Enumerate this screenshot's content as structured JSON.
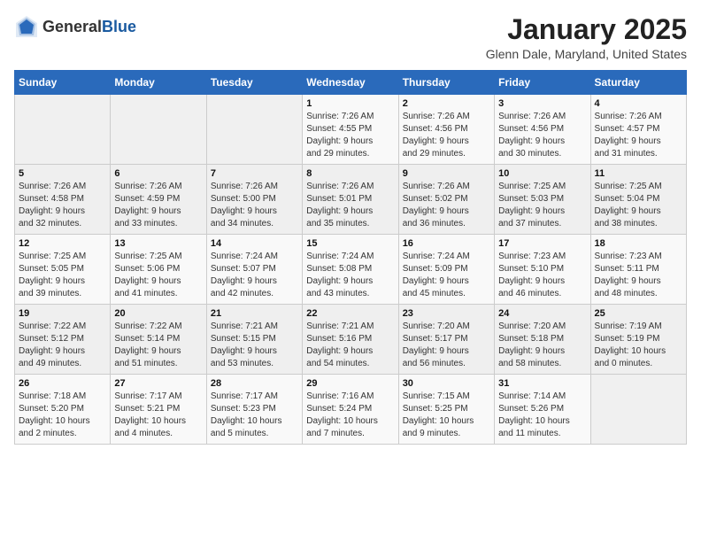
{
  "header": {
    "logo_general": "General",
    "logo_blue": "Blue",
    "title": "January 2025",
    "subtitle": "Glenn Dale, Maryland, United States"
  },
  "weekdays": [
    "Sunday",
    "Monday",
    "Tuesday",
    "Wednesday",
    "Thursday",
    "Friday",
    "Saturday"
  ],
  "weeks": [
    [
      {
        "day": "",
        "detail": ""
      },
      {
        "day": "",
        "detail": ""
      },
      {
        "day": "",
        "detail": ""
      },
      {
        "day": "1",
        "detail": "Sunrise: 7:26 AM\nSunset: 4:55 PM\nDaylight: 9 hours\nand 29 minutes."
      },
      {
        "day": "2",
        "detail": "Sunrise: 7:26 AM\nSunset: 4:56 PM\nDaylight: 9 hours\nand 29 minutes."
      },
      {
        "day": "3",
        "detail": "Sunrise: 7:26 AM\nSunset: 4:56 PM\nDaylight: 9 hours\nand 30 minutes."
      },
      {
        "day": "4",
        "detail": "Sunrise: 7:26 AM\nSunset: 4:57 PM\nDaylight: 9 hours\nand 31 minutes."
      }
    ],
    [
      {
        "day": "5",
        "detail": "Sunrise: 7:26 AM\nSunset: 4:58 PM\nDaylight: 9 hours\nand 32 minutes."
      },
      {
        "day": "6",
        "detail": "Sunrise: 7:26 AM\nSunset: 4:59 PM\nDaylight: 9 hours\nand 33 minutes."
      },
      {
        "day": "7",
        "detail": "Sunrise: 7:26 AM\nSunset: 5:00 PM\nDaylight: 9 hours\nand 34 minutes."
      },
      {
        "day": "8",
        "detail": "Sunrise: 7:26 AM\nSunset: 5:01 PM\nDaylight: 9 hours\nand 35 minutes."
      },
      {
        "day": "9",
        "detail": "Sunrise: 7:26 AM\nSunset: 5:02 PM\nDaylight: 9 hours\nand 36 minutes."
      },
      {
        "day": "10",
        "detail": "Sunrise: 7:25 AM\nSunset: 5:03 PM\nDaylight: 9 hours\nand 37 minutes."
      },
      {
        "day": "11",
        "detail": "Sunrise: 7:25 AM\nSunset: 5:04 PM\nDaylight: 9 hours\nand 38 minutes."
      }
    ],
    [
      {
        "day": "12",
        "detail": "Sunrise: 7:25 AM\nSunset: 5:05 PM\nDaylight: 9 hours\nand 39 minutes."
      },
      {
        "day": "13",
        "detail": "Sunrise: 7:25 AM\nSunset: 5:06 PM\nDaylight: 9 hours\nand 41 minutes."
      },
      {
        "day": "14",
        "detail": "Sunrise: 7:24 AM\nSunset: 5:07 PM\nDaylight: 9 hours\nand 42 minutes."
      },
      {
        "day": "15",
        "detail": "Sunrise: 7:24 AM\nSunset: 5:08 PM\nDaylight: 9 hours\nand 43 minutes."
      },
      {
        "day": "16",
        "detail": "Sunrise: 7:24 AM\nSunset: 5:09 PM\nDaylight: 9 hours\nand 45 minutes."
      },
      {
        "day": "17",
        "detail": "Sunrise: 7:23 AM\nSunset: 5:10 PM\nDaylight: 9 hours\nand 46 minutes."
      },
      {
        "day": "18",
        "detail": "Sunrise: 7:23 AM\nSunset: 5:11 PM\nDaylight: 9 hours\nand 48 minutes."
      }
    ],
    [
      {
        "day": "19",
        "detail": "Sunrise: 7:22 AM\nSunset: 5:12 PM\nDaylight: 9 hours\nand 49 minutes."
      },
      {
        "day": "20",
        "detail": "Sunrise: 7:22 AM\nSunset: 5:14 PM\nDaylight: 9 hours\nand 51 minutes."
      },
      {
        "day": "21",
        "detail": "Sunrise: 7:21 AM\nSunset: 5:15 PM\nDaylight: 9 hours\nand 53 minutes."
      },
      {
        "day": "22",
        "detail": "Sunrise: 7:21 AM\nSunset: 5:16 PM\nDaylight: 9 hours\nand 54 minutes."
      },
      {
        "day": "23",
        "detail": "Sunrise: 7:20 AM\nSunset: 5:17 PM\nDaylight: 9 hours\nand 56 minutes."
      },
      {
        "day": "24",
        "detail": "Sunrise: 7:20 AM\nSunset: 5:18 PM\nDaylight: 9 hours\nand 58 minutes."
      },
      {
        "day": "25",
        "detail": "Sunrise: 7:19 AM\nSunset: 5:19 PM\nDaylight: 10 hours\nand 0 minutes."
      }
    ],
    [
      {
        "day": "26",
        "detail": "Sunrise: 7:18 AM\nSunset: 5:20 PM\nDaylight: 10 hours\nand 2 minutes."
      },
      {
        "day": "27",
        "detail": "Sunrise: 7:17 AM\nSunset: 5:21 PM\nDaylight: 10 hours\nand 4 minutes."
      },
      {
        "day": "28",
        "detail": "Sunrise: 7:17 AM\nSunset: 5:23 PM\nDaylight: 10 hours\nand 5 minutes."
      },
      {
        "day": "29",
        "detail": "Sunrise: 7:16 AM\nSunset: 5:24 PM\nDaylight: 10 hours\nand 7 minutes."
      },
      {
        "day": "30",
        "detail": "Sunrise: 7:15 AM\nSunset: 5:25 PM\nDaylight: 10 hours\nand 9 minutes."
      },
      {
        "day": "31",
        "detail": "Sunrise: 7:14 AM\nSunset: 5:26 PM\nDaylight: 10 hours\nand 11 minutes."
      },
      {
        "day": "",
        "detail": ""
      }
    ]
  ]
}
